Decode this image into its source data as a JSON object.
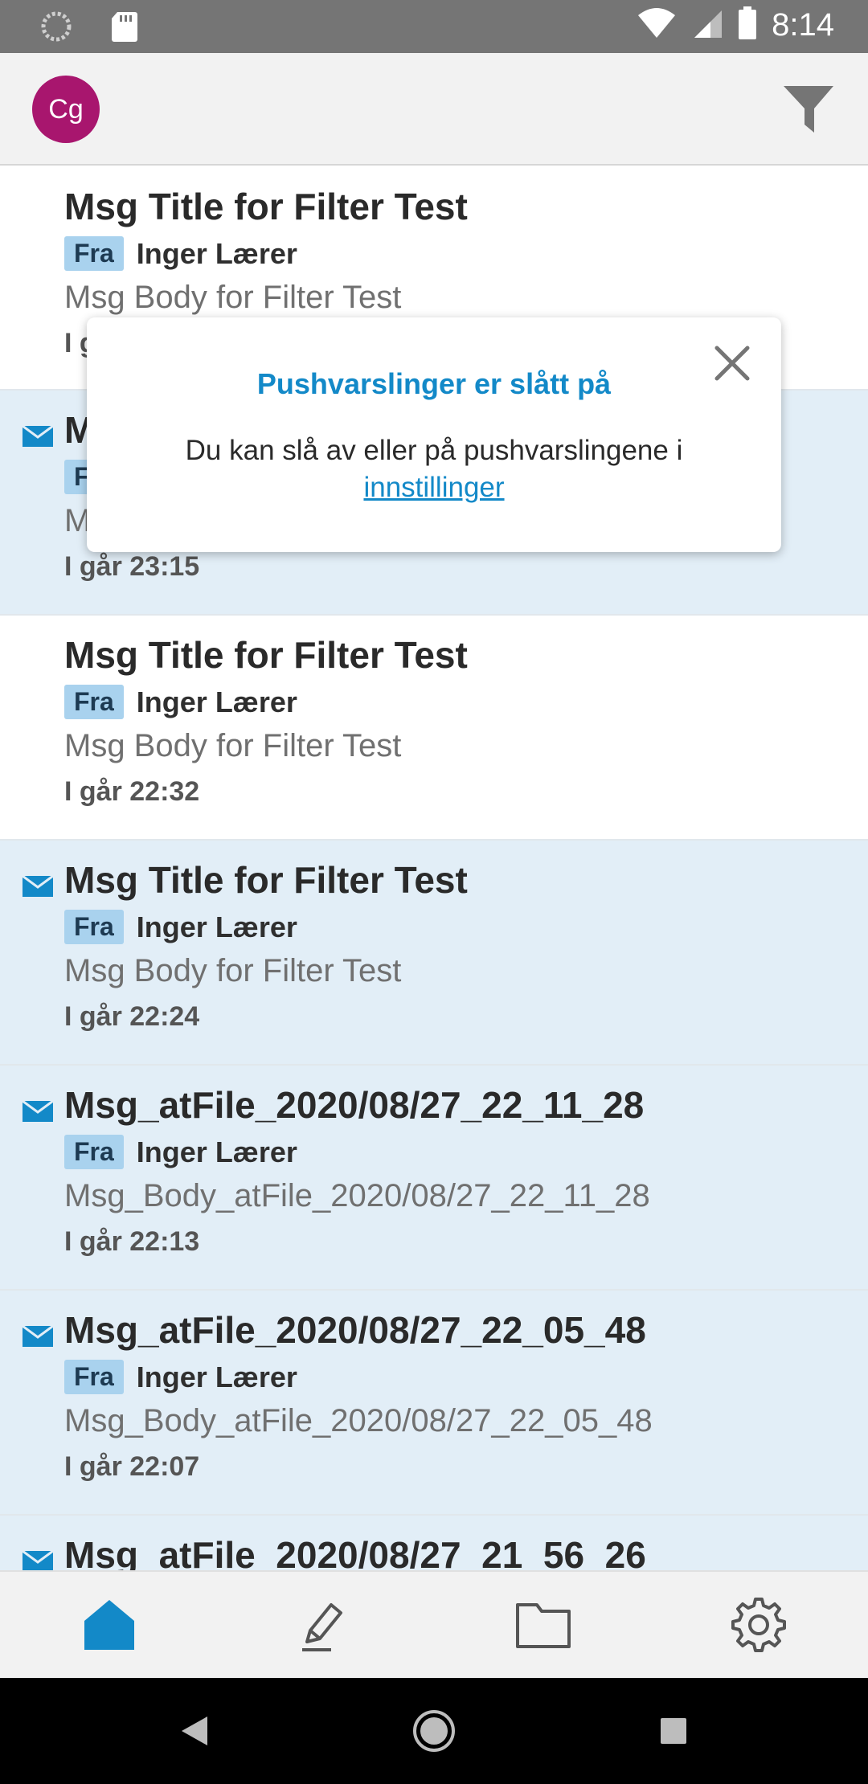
{
  "status_bar": {
    "time": "8:14",
    "icons": [
      "sync-icon",
      "sd-card-icon",
      "wifi-icon",
      "signal-icon",
      "battery-icon"
    ]
  },
  "header": {
    "avatar_initials": "Cg",
    "avatar_color": "#a8166e",
    "filter_icon": "filter-icon"
  },
  "messages": [
    {
      "title": "Msg Title for Filter Test",
      "from_label": "Fra",
      "sender": "Inger Lærer",
      "body": "Msg Body for Filter Test",
      "time": "I g",
      "unread": false
    },
    {
      "title": "M",
      "from_label": "F",
      "sender": "",
      "body": "M",
      "time": "I går 23:15",
      "unread": true
    },
    {
      "title": "Msg Title for Filter Test",
      "from_label": "Fra",
      "sender": "Inger Lærer",
      "body": "Msg Body for Filter Test",
      "time": "I går 22:32",
      "unread": false
    },
    {
      "title": "Msg Title for Filter Test",
      "from_label": "Fra",
      "sender": "Inger Lærer",
      "body": "Msg Body for Filter Test",
      "time": "I går 22:24",
      "unread": true
    },
    {
      "title": "Msg_atFile_2020/08/27_22_11_28",
      "from_label": "Fra",
      "sender": "Inger Lærer",
      "body": "Msg_Body_atFile_2020/08/27_22_11_28",
      "time": "I går 22:13",
      "unread": true
    },
    {
      "title": "Msg_atFile_2020/08/27_22_05_48",
      "from_label": "Fra",
      "sender": "Inger Lærer",
      "body": "Msg_Body_atFile_2020/08/27_22_05_48",
      "time": "I går 22:07",
      "unread": true
    },
    {
      "title": "Msg_atFile_2020/08/27_21_56_26",
      "from_label": "",
      "sender": "",
      "body": "",
      "time": "",
      "unread": true
    }
  ],
  "popup": {
    "title": "Pushvarslinger er slått på",
    "text": "Du kan slå av eller på pushvarslingene i",
    "link": "innstillinger"
  },
  "bottom_nav": {
    "items": [
      "home-icon",
      "compose-icon",
      "folder-icon",
      "settings-icon"
    ],
    "active": "home-icon",
    "accent": "#1389c8"
  },
  "colors": {
    "unread_bg": "#e2eef7",
    "badge_bg": "#a9d2ee",
    "link": "#1389c8"
  }
}
